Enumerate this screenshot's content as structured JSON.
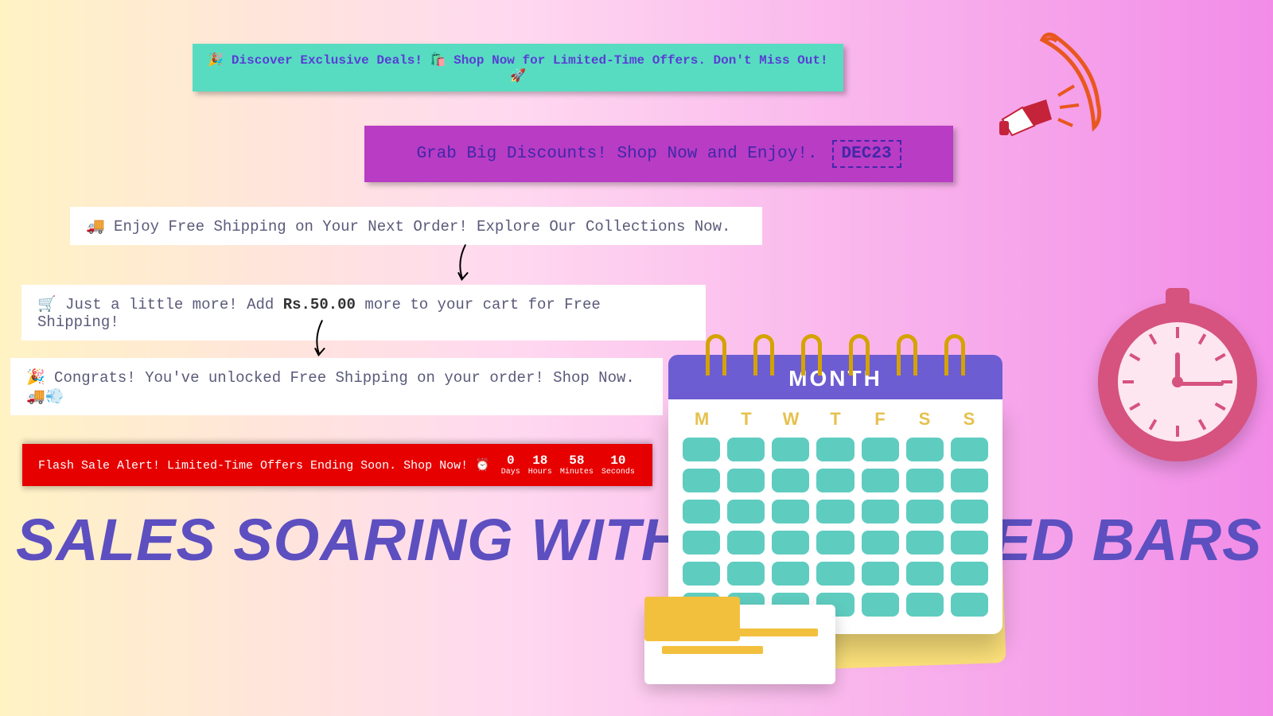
{
  "bars": {
    "teal": "🎉 Discover Exclusive Deals! 🛍️ Shop Now for Limited-Time Offers. Don't Miss Out! 🚀",
    "purple_text": "Grab Big Discounts! Shop Now and Enjoy!.",
    "purple_code": "DEC23",
    "ship1": "🚚 Enjoy Free Shipping on Your Next Order! Explore Our Collections Now.",
    "ship2_pre": "🛒 Just a little more! Add ",
    "ship2_bold": "Rs.50.00",
    "ship2_post": " more to your cart for Free Shipping!",
    "ship3": "🎉 Congrats! You've unlocked Free Shipping on your order! Shop Now. 🚚💨",
    "flash_text": "Flash Sale Alert! Limited-Time Offers Ending Soon. Shop Now! ⏰"
  },
  "countdown": {
    "days": "0",
    "days_lbl": "Days",
    "hours": "18",
    "hours_lbl": "Hours",
    "minutes": "58",
    "minutes_lbl": "Minutes",
    "seconds": "10",
    "seconds_lbl": "Seconds"
  },
  "headline": "SALES SOARING WITH SCHEDULED BARS",
  "calendar": {
    "title": "MONTH",
    "days": [
      "M",
      "T",
      "W",
      "T",
      "F",
      "S",
      "S"
    ]
  }
}
